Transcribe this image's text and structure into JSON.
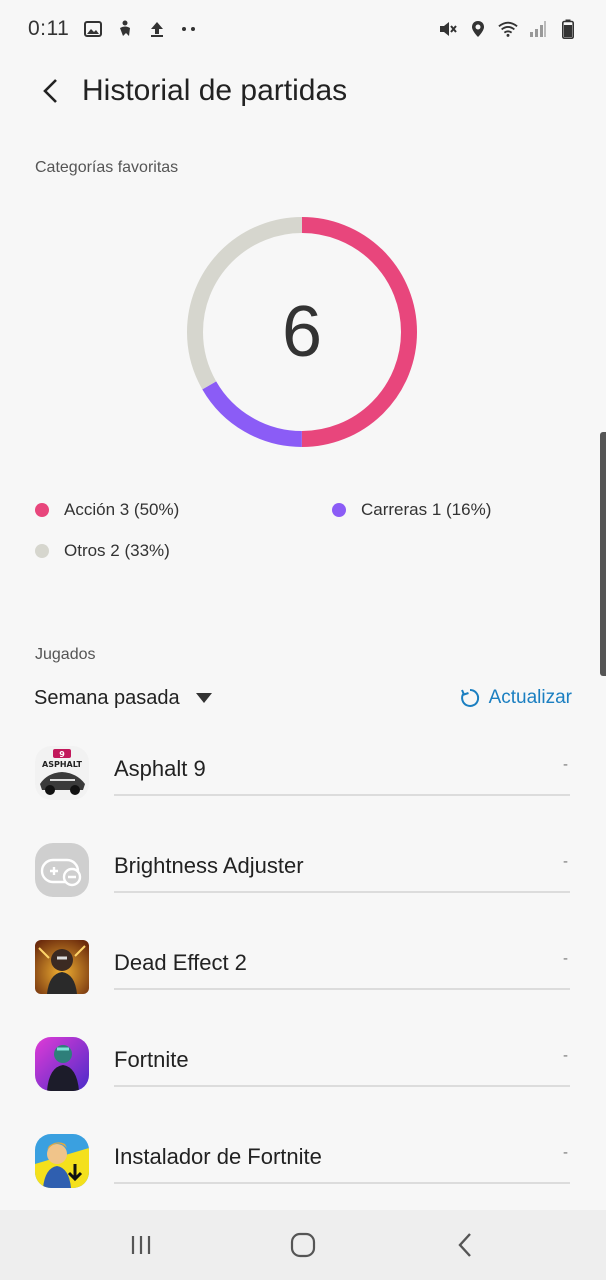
{
  "status_bar": {
    "time": "0:11",
    "left_icons": [
      "image-icon",
      "accessibility-icon",
      "upload-icon",
      "more-dots-icon"
    ],
    "right_icons": [
      "mute-icon",
      "location-icon",
      "wifi-icon",
      "signal-icon",
      "battery-icon"
    ]
  },
  "header": {
    "title": "Historial de partidas"
  },
  "favorites": {
    "section_label": "Categorías favoritas",
    "total": "6",
    "categories": [
      {
        "label": "Acción 3 (50%)",
        "count": 3,
        "color": "#e8467c"
      },
      {
        "label": "Carreras 1 (16%)",
        "count": 1,
        "color": "#8b5cf6"
      },
      {
        "label": "Otros 2 (33%)",
        "count": 2,
        "color": "#d6d6ce"
      }
    ]
  },
  "played": {
    "section_label": "Jugados",
    "period": "Semana pasada",
    "refresh_label": "Actualizar",
    "games": [
      {
        "name": "Asphalt 9",
        "value": "-"
      },
      {
        "name": "Brightness Adjuster",
        "value": "-"
      },
      {
        "name": "Dead Effect 2",
        "value": "-"
      },
      {
        "name": "Fortnite",
        "value": "-"
      },
      {
        "name": "Instalador de Fortnite",
        "value": "-"
      }
    ]
  },
  "colors": {
    "accent_blue": "#1b7fc1",
    "background": "#f7f7f7"
  }
}
